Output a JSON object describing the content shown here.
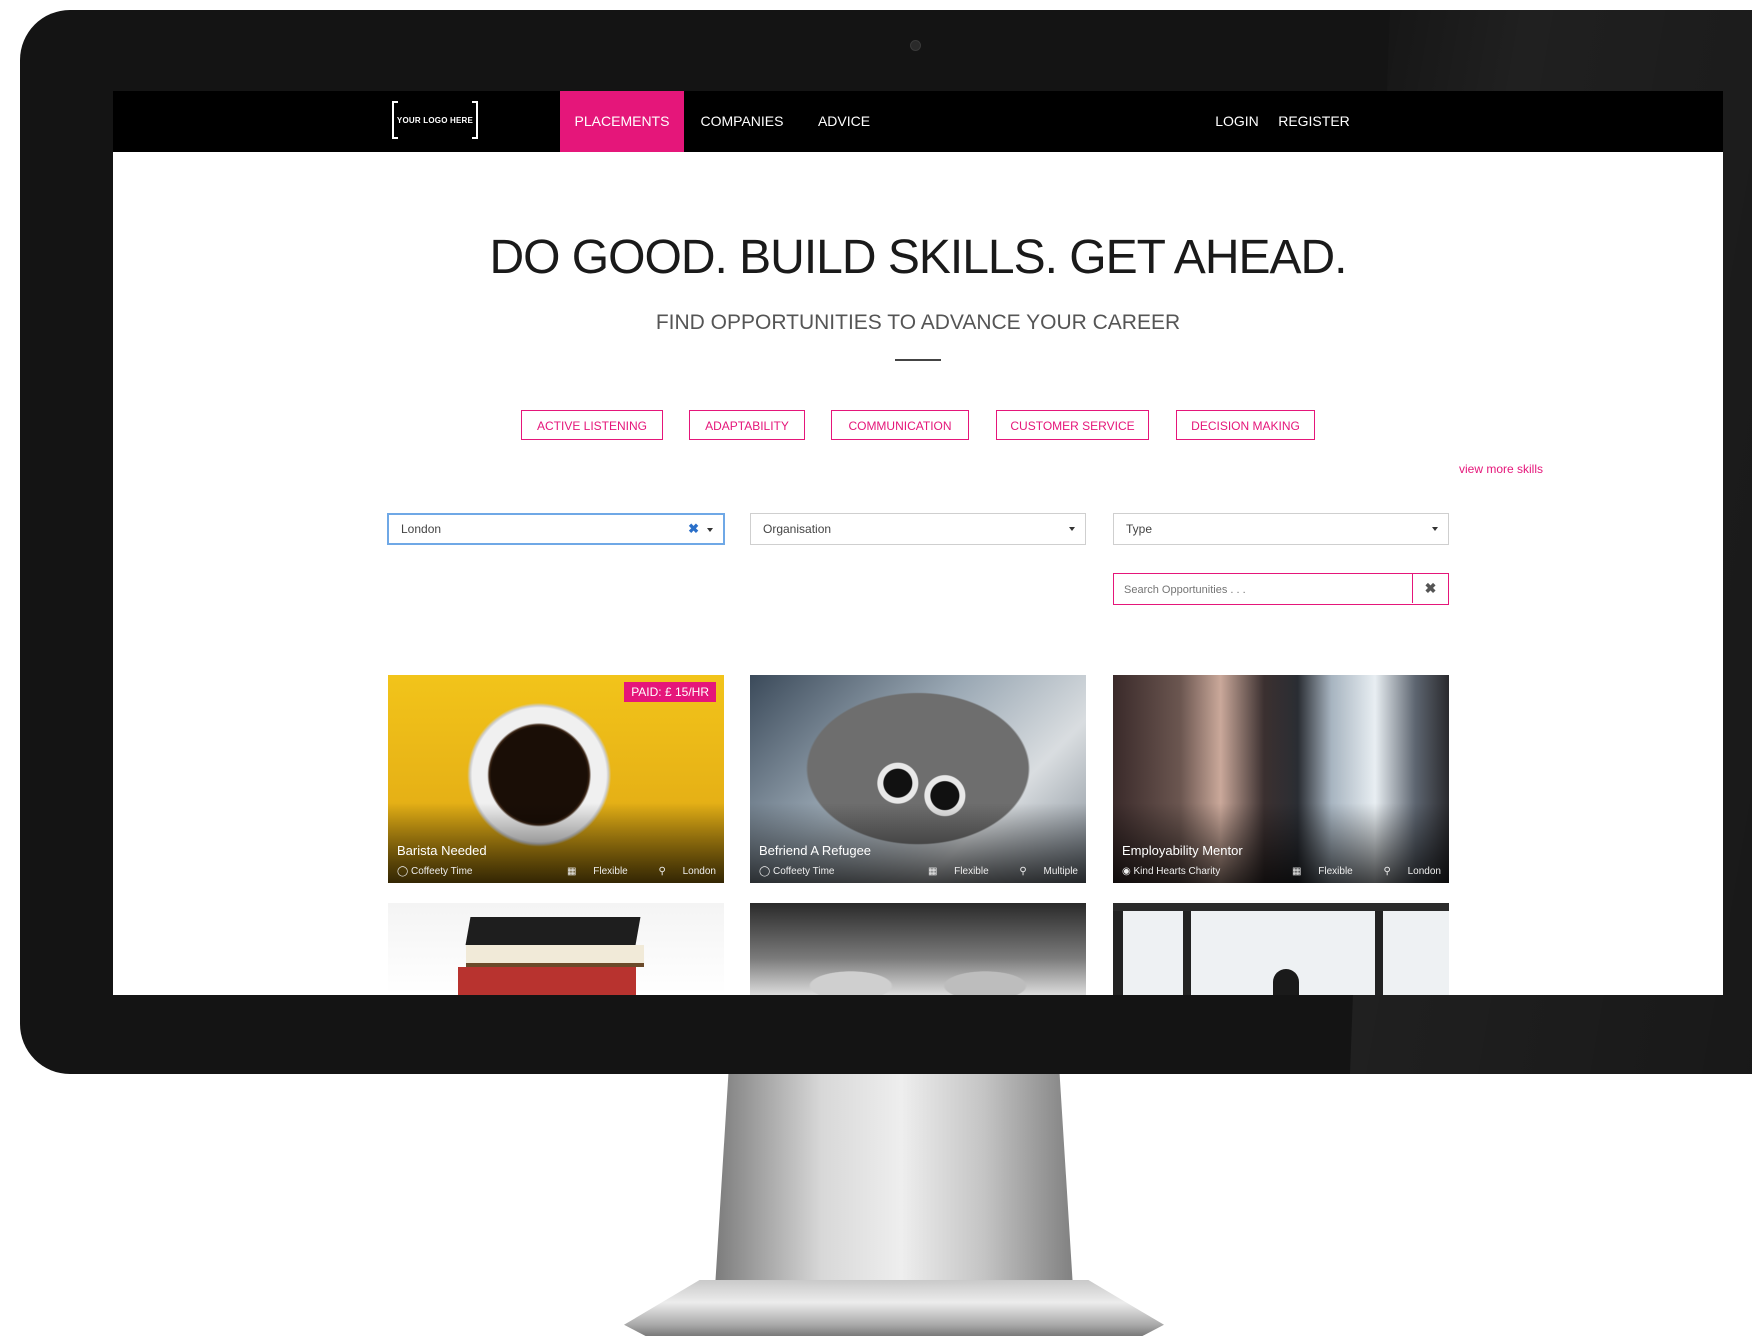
{
  "nav": {
    "logo_text": "YOUR LOGO HERE",
    "items": [
      {
        "label": "PLACEMENTS",
        "active": true
      },
      {
        "label": "COMPANIES",
        "active": false
      },
      {
        "label": "ADVICE",
        "active": false
      }
    ],
    "login_label": "LOGIN",
    "register_label": "REGISTER"
  },
  "hero": {
    "title": "DO GOOD. BUILD SKILLS. GET AHEAD.",
    "subtitle": "FIND OPPORTUNITIES TO ADVANCE YOUR CAREER"
  },
  "skills": {
    "chips": [
      "ACTIVE LISTENING",
      "ADAPTABILITY",
      "COMMUNICATION",
      "CUSTOMER SERVICE",
      "DECISION MAKING"
    ],
    "more_label": "view more skills"
  },
  "filters": {
    "location_value": "London",
    "organisation_placeholder": "Organisation",
    "type_placeholder": "Type",
    "search_placeholder": "Search Opportunities . . ."
  },
  "cards": [
    {
      "title": "Barista Needed",
      "org": "Coffeety Time",
      "schedule": "Flexible",
      "location": "London",
      "badge": "PAID: £ 15/HR"
    },
    {
      "title": "Befriend A Refugee",
      "org": "Coffeety Time",
      "schedule": "Flexible",
      "location": "Multiple"
    },
    {
      "title": "Employability Mentor",
      "org": "Kind Hearts Charity",
      "schedule": "Flexible",
      "location": "London"
    }
  ],
  "colors": {
    "accent": "#e5167a",
    "nav_bg": "#000000",
    "focus": "#6fa8e6"
  }
}
